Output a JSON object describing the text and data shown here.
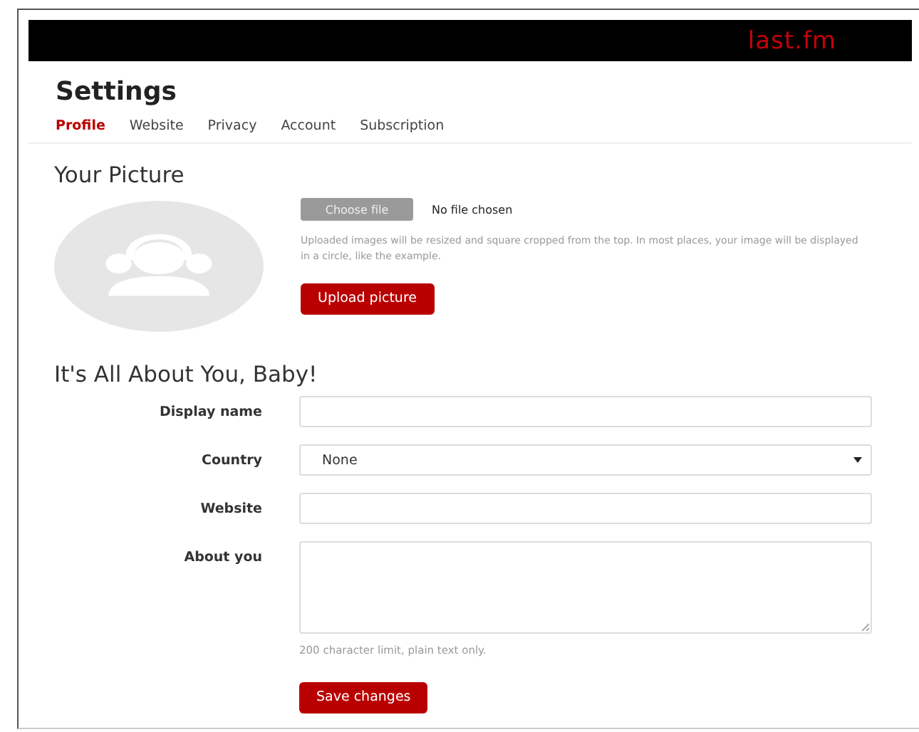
{
  "header": {
    "logo": "last.fm"
  },
  "page": {
    "title": "Settings"
  },
  "tabs": [
    {
      "label": "Profile",
      "selected": true
    },
    {
      "label": "Website",
      "selected": false
    },
    {
      "label": "Privacy",
      "selected": false
    },
    {
      "label": "Account",
      "selected": false
    },
    {
      "label": "Subscription",
      "selected": false
    }
  ],
  "picture": {
    "heading": "Your Picture",
    "file_button": "Choose file",
    "file_status": "No file chosen",
    "help": "Uploaded images will be resized and square cropped from the top. In most places, your image will be displayed in a circle, like the example.",
    "upload_button": "Upload picture"
  },
  "about": {
    "heading": "It's All About You, Baby!",
    "fields": [
      {
        "kind": "text",
        "label": "Display name"
      },
      {
        "kind": "select",
        "label": "Country",
        "value": "None"
      },
      {
        "kind": "text",
        "label": "Website"
      },
      {
        "kind": "textarea",
        "label": "About you",
        "hint": "200 character limit, plain text only."
      }
    ],
    "save_button": "Save changes"
  }
}
